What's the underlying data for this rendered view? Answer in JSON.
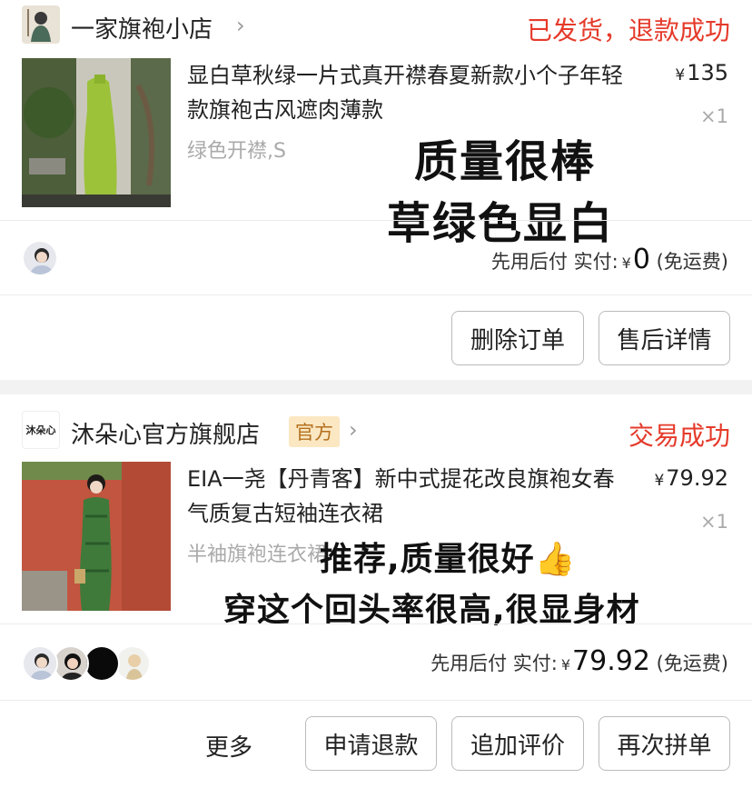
{
  "orders": [
    {
      "shop_name": "一家旗袍小店",
      "status": "已发货，退款成功",
      "product_title": "显白草秋绿一片式真开襟春夏新款小个子年轻款旗袍古风遮肉薄款",
      "spec": "绿色开襟,S",
      "price": "135",
      "currency": "¥",
      "qty": "×1",
      "review_overlay": [
        "质量很棒",
        "草绿色显白"
      ],
      "payment_label": "先用后付 实付:",
      "paid_amount": "0",
      "shipping_note": "(免运费)",
      "buttons": [
        "删除订单",
        "售后详情"
      ]
    },
    {
      "shop_logo_text": "沐朵心",
      "shop_name": "沐朵心官方旗舰店",
      "official_badge": "官方",
      "status": "交易成功",
      "product_title": "EIA一尧【丹青客】新中式提花改良旗袍女春气质复古短袖连衣裙",
      "spec": "半袖旗袍连衣裙",
      "price": "79.92",
      "currency": "¥",
      "qty": "×1",
      "review_overlay": [
        "推荐,质量很好👍",
        "穿这个回头率很高,很显身材"
      ],
      "payment_label": "先用后付 实付:",
      "paid_amount": "79.92",
      "shipping_note": "(免运费)",
      "more_label": "更多",
      "buttons": [
        "申请退款",
        "追加评价",
        "再次拼单"
      ]
    }
  ],
  "icons": {
    "chevron": "chevron-right-icon"
  },
  "colors": {
    "status_red": "#e53a2a",
    "badge_bg": "#fbe7c2",
    "badge_text": "#b4701e",
    "section_gap": "#f2f2f2"
  }
}
